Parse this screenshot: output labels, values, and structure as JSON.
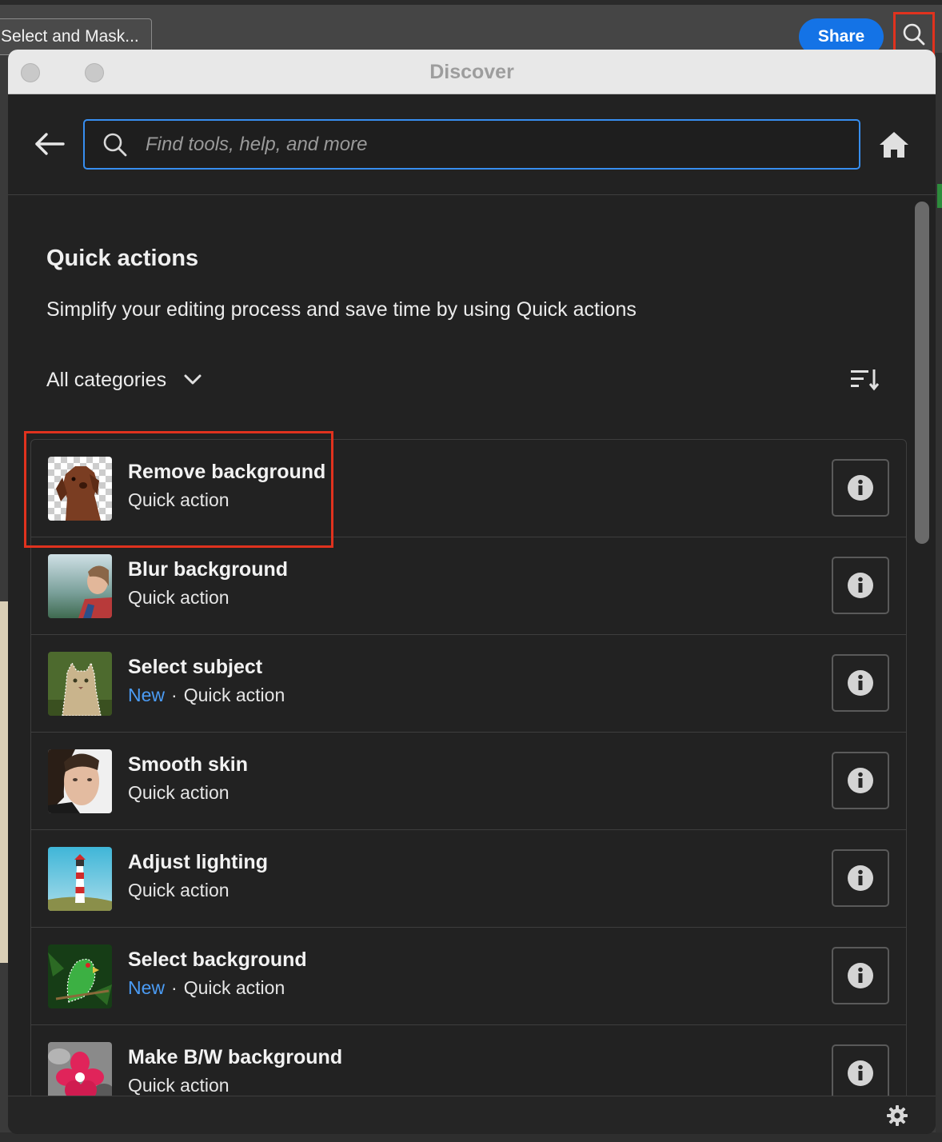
{
  "app": {
    "select_mask_label": "Select and Mask...",
    "share_label": "Share",
    "search_icon": "search-icon"
  },
  "panel": {
    "title": "Discover",
    "search": {
      "placeholder": "Find tools, help, and more"
    },
    "section_title": "Quick actions",
    "section_desc": "Simplify your editing process and save time by using Quick actions",
    "category_filter": "All categories",
    "items": [
      {
        "title": "Remove background",
        "new_badge": "",
        "subtitle": "Quick action",
        "thumb": "dog-transparent"
      },
      {
        "title": "Blur background",
        "new_badge": "",
        "subtitle": "Quick action",
        "thumb": "woman-outdoor"
      },
      {
        "title": "Select subject",
        "new_badge": "New",
        "subtitle": "Quick action",
        "thumb": "cat"
      },
      {
        "title": "Smooth skin",
        "new_badge": "",
        "subtitle": "Quick action",
        "thumb": "man-portrait"
      },
      {
        "title": "Adjust lighting",
        "new_badge": "",
        "subtitle": "Quick action",
        "thumb": "lighthouse"
      },
      {
        "title": "Select background",
        "new_badge": "New",
        "subtitle": "Quick action",
        "thumb": "parrot"
      },
      {
        "title": "Make B/W background",
        "new_badge": "",
        "subtitle": "Quick action",
        "thumb": "pink-flower"
      }
    ]
  },
  "colors": {
    "accent": "#1473e6",
    "new_badge": "#4b9cf5",
    "highlight": "#e0321e"
  }
}
